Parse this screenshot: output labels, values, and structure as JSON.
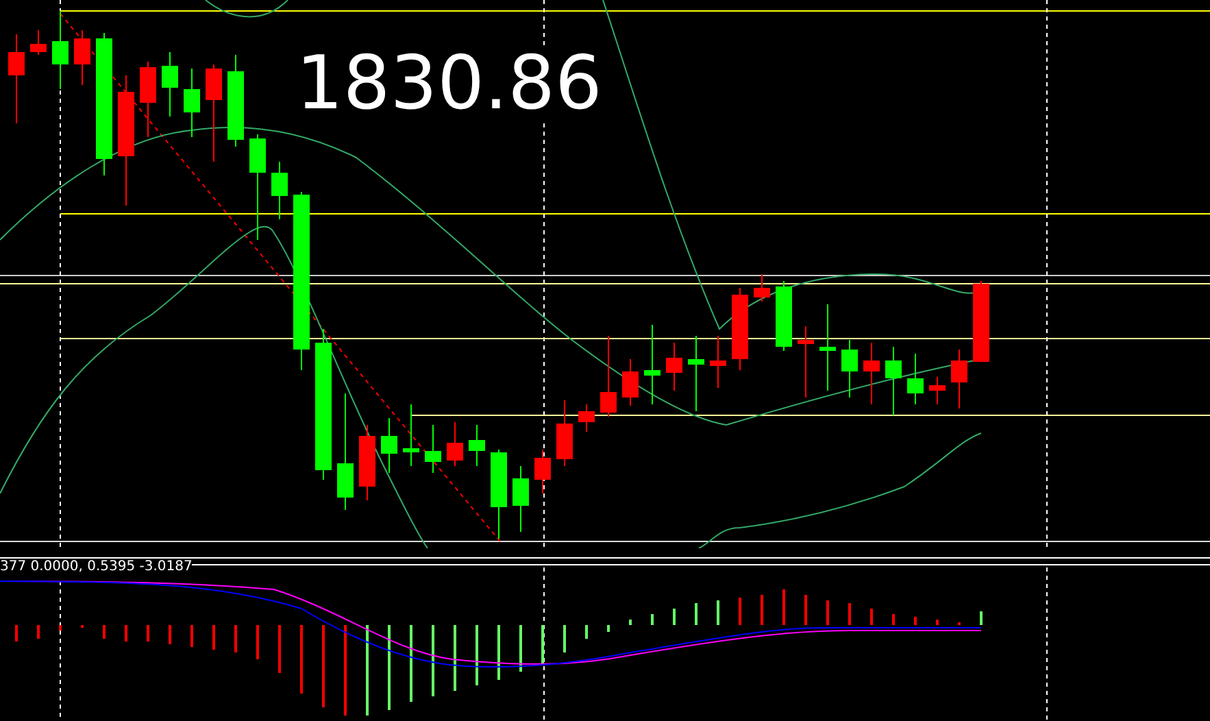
{
  "price_label": {
    "text": "1830.86"
  },
  "indicator_legend": {
    "text": "377 0.0000, 0.5395 -3.0187"
  }
}
